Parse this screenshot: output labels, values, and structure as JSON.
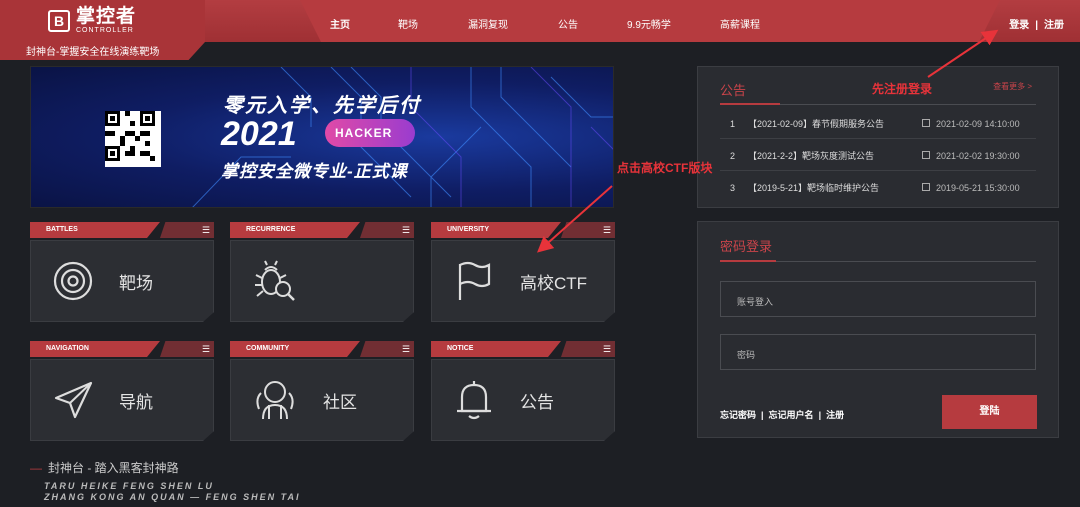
{
  "header": {
    "logo_mark": "B",
    "logo_cn": "掌控者",
    "logo_en": "CONTROLLER",
    "tagline": "封神台-掌握安全在线演练靶场",
    "nav": [
      "主页",
      "靶场",
      "漏洞复现",
      "公告",
      "9.9元畅学",
      "高薪课程"
    ],
    "login": "登录",
    "separator": "|",
    "register": "注册",
    "colors": {
      "brand": "#b63b3f",
      "background": "#1d1f24"
    }
  },
  "banner": {
    "line1": "零元入学、先学后付",
    "year": "2021",
    "badge": "HACKER",
    "line3": "掌控安全微专业-正式课"
  },
  "cards": [
    {
      "tag": "BATTLES",
      "label": "靶场",
      "icon": "target-icon"
    },
    {
      "tag": "RECURRENCE",
      "label": "",
      "icon": "bug-search-icon"
    },
    {
      "tag": "UNIVERSITY",
      "label": "高校CTF",
      "icon": "flag-icon"
    },
    {
      "tag": "NAVIGATION",
      "label": "导航",
      "icon": "navigation-arrow-icon"
    },
    {
      "tag": "COMMUNITY",
      "label": "社区",
      "icon": "community-people-icon"
    },
    {
      "tag": "NOTICE",
      "label": "公告",
      "icon": "bell-icon"
    }
  ],
  "footer": {
    "title": "封神台 - 踏入黑客封神路",
    "en1": "TARU HEIKE FENG SHEN LU",
    "en2": "ZHANG KONG AN QUAN — FENG SHEN TAI"
  },
  "announcements": {
    "title": "公告",
    "more": "查看更多 >",
    "items": [
      {
        "num": "1",
        "text": "【2021-02-09】春节假期服务公告",
        "date": "2021-02-09 14:10:00"
      },
      {
        "num": "2",
        "text": "【2021-2-2】靶场灰度测试公告",
        "date": "2021-02-02 19:30:00"
      },
      {
        "num": "3",
        "text": "【2019-5-21】靶场临时维护公告",
        "date": "2019-05-21 15:30:00"
      }
    ]
  },
  "login": {
    "title": "密码登录",
    "account_placeholder": "账号登入",
    "password_placeholder": "密码",
    "forgot_password": "忘记密码",
    "forgot_username": "忘记用户名",
    "register": "注册",
    "separator": "|",
    "submit": "登陆"
  },
  "annotations": {
    "register_first": "先注册登录",
    "click_ctf": "点击高校CTF版块",
    "color": "#e8333a"
  }
}
